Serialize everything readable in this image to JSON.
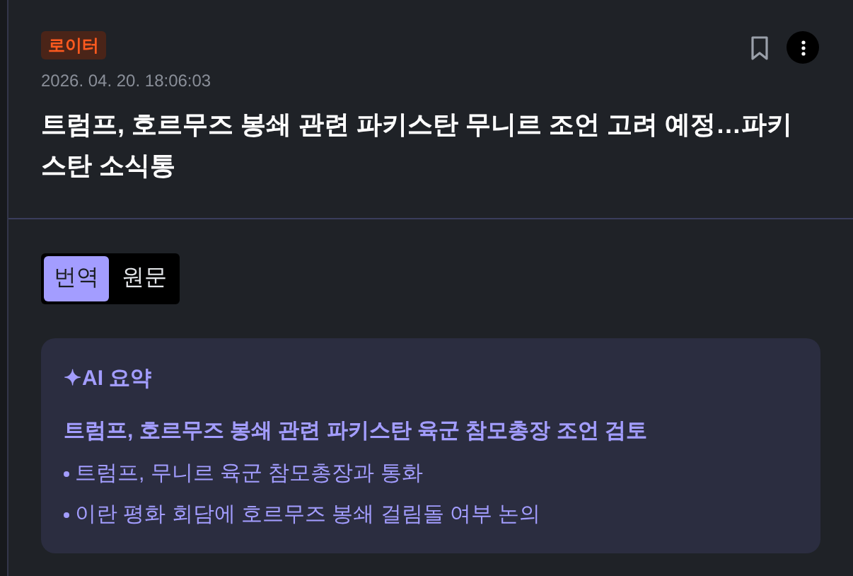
{
  "source_badge": "로이터",
  "timestamp": "2026. 04. 20. 18:06:03",
  "headline": "트럼프, 호르무즈 봉쇄 관련 파키스탄 무니르 조언 고려 예정…파키스탄 소식통",
  "bookmarked": false,
  "view_tabs": [
    {
      "label": "번역",
      "selected": true
    },
    {
      "label": "원문",
      "selected": false
    }
  ],
  "summary": {
    "title": "✦AI 요약",
    "headline": "트럼프, 호르무즈 봉쇄 관련 파키스탄 육군 참모총장 조언 검토",
    "points": [
      "트럼프, 무니르 육군 참모총장과 통화",
      "이란 평화 회담에 호르무즈 봉쇄 걸림돌 여부 논의"
    ]
  }
}
